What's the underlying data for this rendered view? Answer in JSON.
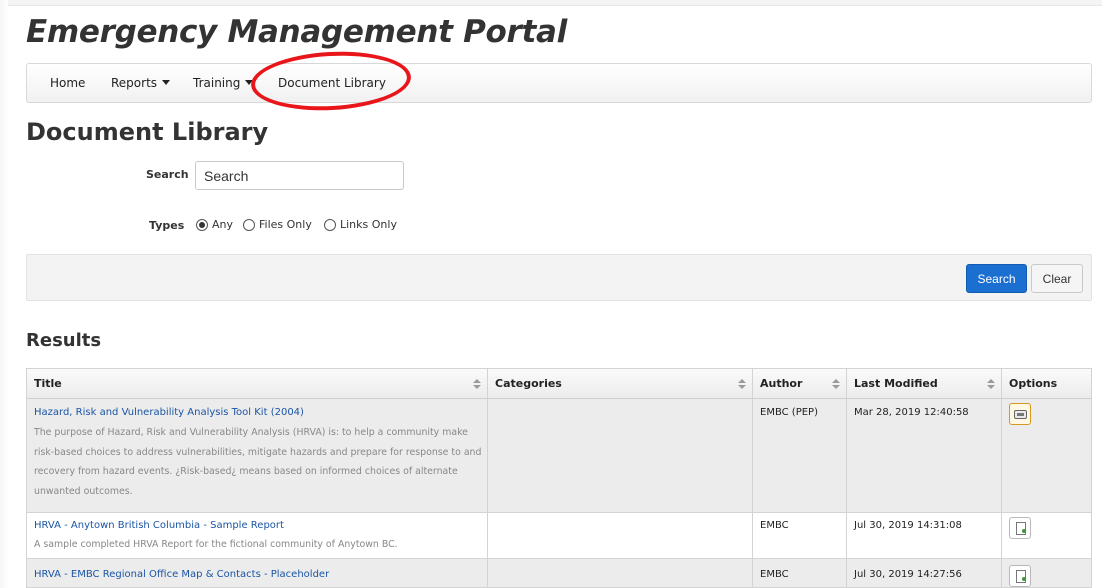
{
  "header": {
    "portal_title": "Emergency Management Portal"
  },
  "nav": {
    "items": [
      {
        "label": "Home",
        "has_dropdown": false
      },
      {
        "label": "Reports",
        "has_dropdown": true
      },
      {
        "label": "Training",
        "has_dropdown": true
      },
      {
        "label": "Document Library",
        "has_dropdown": false,
        "annotated": true
      }
    ],
    "annotation_color": "#e8161b"
  },
  "page": {
    "title": "Document Library"
  },
  "filters": {
    "search_label": "Search",
    "search_placeholder": "Search",
    "types_label": "Types",
    "type_options": [
      {
        "label": "Any",
        "checked": true
      },
      {
        "label": "Files Only",
        "checked": false
      },
      {
        "label": "Links Only",
        "checked": false
      }
    ]
  },
  "actions": {
    "search_label": "Search",
    "clear_label": "Clear",
    "primary_color": "#1a6fd0"
  },
  "results": {
    "title": "Results",
    "columns": [
      "Title",
      "Categories",
      "Author",
      "Last Modified",
      "Options"
    ],
    "rows": [
      {
        "title": "Hazard, Risk and Vulnerability Analysis Tool Kit (2004)",
        "description": "The purpose of Hazard, Risk and Vulnerability Analysis (HRVA) is: to help a community make risk-based choices to address vulnerabilities, mitigate hazards and prepare for response to and recovery from hazard events. ¿Risk-based¿ means based on informed choices of alternate unwanted outcomes.",
        "categories": "",
        "author": "EMBC (PEP)",
        "last_modified": "Mar 28, 2019 12:40:58",
        "option_icon": "link-icon"
      },
      {
        "title": "HRVA - Anytown British Columbia - Sample Report",
        "description": "A sample completed HRVA Report for the fictional community of Anytown BC.",
        "categories": "",
        "author": "EMBC",
        "last_modified": "Jul 30, 2019 14:31:08",
        "option_icon": "file-download-icon"
      },
      {
        "title": "HRVA - EMBC Regional Office Map & Contacts - Placeholder",
        "description": "",
        "categories": "",
        "author": "EMBC",
        "last_modified": "Jul 30, 2019 14:27:56",
        "option_icon": "file-download-icon"
      }
    ]
  }
}
